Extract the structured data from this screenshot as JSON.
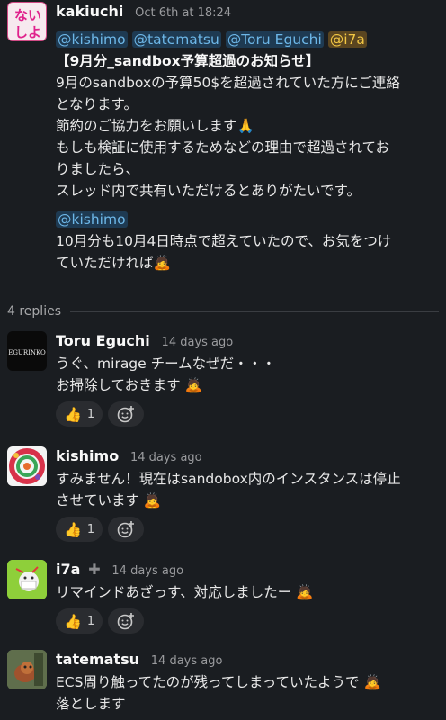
{
  "parent": {
    "author": "kakiuchi",
    "time": "Oct 6th at 18:24",
    "avatar_text": "ない\nしよ",
    "mentions": [
      "@kishimo",
      "@tatematsu",
      "@Toru Eguchi",
      "@i7a"
    ],
    "title": "【9月分_sandbox予算超過のお知らせ】",
    "lines": [
      "9月のsandboxの予算50$を超過されていた方にご連絡",
      "となります。",
      "節約のご協力をお願いします🙏",
      "もしも検証に使用するためなどの理由で超過されてお",
      "りましたら、",
      "スレッド内で共有いただけるとありがたいです。"
    ],
    "mention2": "@kishimo",
    "lines2": [
      "10月分も10月4日時点で超えていたので、お気をつけ",
      "ていただければ🙇"
    ]
  },
  "replies_label": "4 replies",
  "replies": [
    {
      "author": "Toru Eguchi",
      "time": "14 days ago",
      "avatar_text": "EGURINKO",
      "lines": [
        "うぐ、mirage チームなぜだ・・・",
        "お掃除しておきます 🙇"
      ],
      "reaction_emoji": "👍",
      "reaction_count": "1"
    },
    {
      "author": "kishimo",
      "time": "14 days ago",
      "lines": [
        "すみません！現在はsandobox内のインスタンスは停止",
        "させています 🙇"
      ],
      "reaction_emoji": "👍",
      "reaction_count": "1"
    },
    {
      "author": "i7a",
      "time": "14 days ago",
      "lines": [
        "リマインドあざっす、対応しましたー 🙇"
      ],
      "reaction_emoji": "👍",
      "reaction_count": "1"
    },
    {
      "author": "tatematsu",
      "time": "14 days ago",
      "lines": [
        "ECS周り触ってたのが残ってしまっていたようで 🙇",
        "落とします"
      ]
    }
  ],
  "add_reaction_icon": "add-reaction-icon"
}
